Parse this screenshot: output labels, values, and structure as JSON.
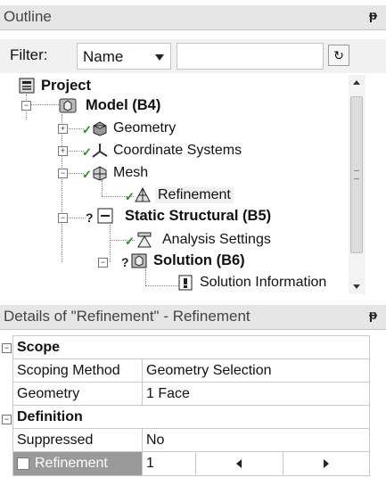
{
  "outline": {
    "title": "Outline",
    "pin_glyph": "P",
    "filter": {
      "label": "Filter:",
      "selected": "Name",
      "text": ""
    },
    "tree": {
      "project": "Project",
      "model": "Model (B4)",
      "geometry": "Geometry",
      "coordinate_systems": "Coordinate Systems",
      "mesh": "Mesh",
      "refinement": "Refinement",
      "static_structural": "Static Structural (B5)",
      "analysis_settings": "Analysis Settings",
      "solution": "Solution (B6)",
      "solution_information": "Solution Information"
    }
  },
  "details": {
    "title": "Details of \"Refinement\" - Refinement",
    "sections": [
      {
        "name": "Scope",
        "rows": [
          {
            "label": "Scoping Method",
            "value": "Geometry Selection"
          },
          {
            "label": "Geometry",
            "value": "1 Face"
          }
        ]
      },
      {
        "name": "Definition",
        "rows": [
          {
            "label": "Suppressed",
            "value": "No"
          },
          {
            "label": "Refinement",
            "value": "1"
          }
        ]
      }
    ]
  },
  "icons": {
    "pin": "pin-icon",
    "project": "project-icon",
    "model": "model-icon",
    "geometry": "geometry-icon",
    "coordinates": "coordinate-systems-icon",
    "mesh": "mesh-icon",
    "refinement": "refinement-icon",
    "static_structural": "static-structural-icon",
    "analysis_settings": "analysis-settings-icon",
    "solution": "solution-icon",
    "solution_information": "solution-information-icon"
  }
}
